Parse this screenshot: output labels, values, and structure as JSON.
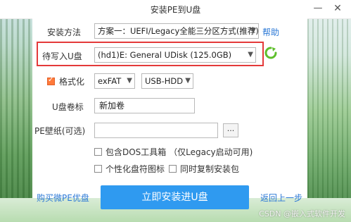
{
  "window": {
    "title": "安装PE到U盘",
    "minimize_glyph": "—",
    "close_glyph": "✕"
  },
  "install_method": {
    "label": "安装方法",
    "value": "方案一：UEFI/Legacy全能三分区方式(推荐)",
    "help": "帮助"
  },
  "target_drive": {
    "label": "待写入U盘",
    "value": "(hd1)E: General UDisk (125.0GB)"
  },
  "format": {
    "label": "格式化",
    "checked": true,
    "fs_value": "exFAT",
    "mode_value": "USB-HDD"
  },
  "volume_label": {
    "label": "U盘卷标",
    "value": "新加卷"
  },
  "wallpaper": {
    "label": "PE壁纸(可选)",
    "value": "",
    "browse_label": "..."
  },
  "options": {
    "dos_tools": {
      "label": "包含DOS工具箱 （仅Legacy启动可用)",
      "checked": false
    },
    "custom_icon": {
      "label": "个性化盘符图标",
      "checked": false
    },
    "copy_installer": {
      "label": "同时复制安装包",
      "checked": false
    }
  },
  "footer": {
    "buy_link": "购买微PE优盘",
    "install_button": "立即安装进U盘",
    "back_link": "返回上一步"
  },
  "watermark": "CSDN @嵌入式软件开发",
  "colors": {
    "accent": "#2f9af0",
    "link": "#2b78d6",
    "highlight_border": "#e43a3a",
    "checkbox_checked": "#ff7a3a",
    "refresh_icon": "#5fbf2c"
  }
}
